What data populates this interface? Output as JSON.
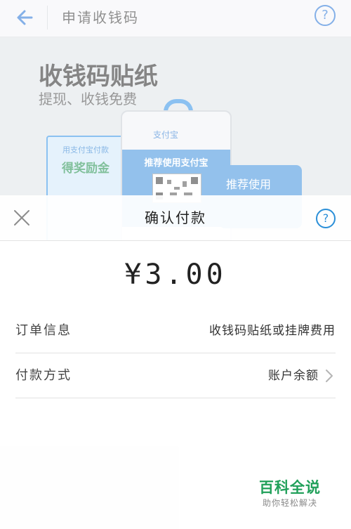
{
  "background_page": {
    "title": "申请收钱码",
    "banner_title": "收钱码贴纸",
    "banner_subtitle": "提现、收钱免费",
    "card_left_line1": "用支付宝付款",
    "card_left_line2": "得奖励金",
    "card_center_brand": "支付宝",
    "card_center_text": "推荐使用支付宝",
    "card_right_text": "推荐使用"
  },
  "sheet": {
    "title": "确认付款",
    "amount": "¥3.00",
    "rows": [
      {
        "label": "订单信息",
        "value": "收钱码贴纸或挂牌费用"
      },
      {
        "label": "付款方式",
        "value": "账户余额"
      }
    ]
  },
  "watermark": {
    "brand": "百科全说",
    "slogan": "助你轻松解决"
  },
  "colors": {
    "accent": "#2b8fd8",
    "brand_green": "#21a05a"
  },
  "icons": [
    "back-arrow-icon",
    "help-icon",
    "close-icon",
    "chevron-right-icon"
  ]
}
